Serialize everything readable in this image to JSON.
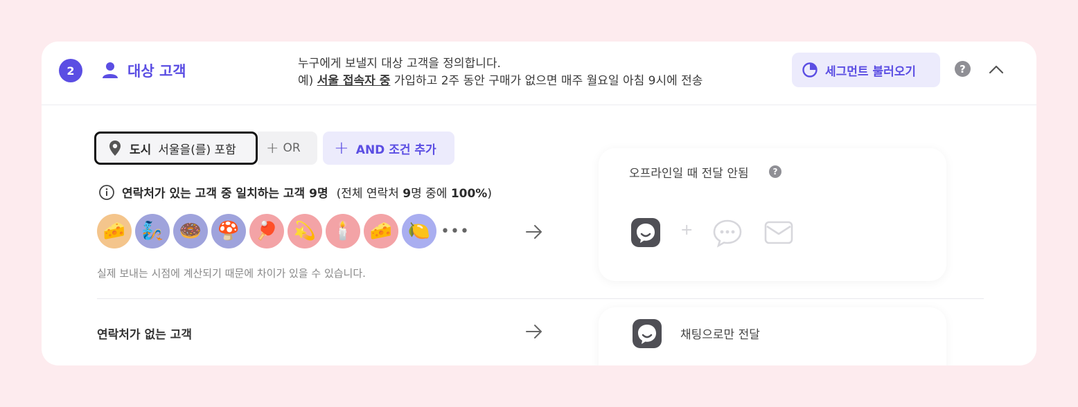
{
  "header": {
    "step_number": "2",
    "title": "대상 고객",
    "description_line1": "누구에게 보낼지 대상 고객을 정의합니다.",
    "description_prefix": "예) ",
    "description_emphasis": "서울 접속자 중",
    "description_suffix": " 가입하고 2주 동안 구매가 없으면 매주 월요일 아침 9시에 전송",
    "segment_button": "세그먼트 불러오기",
    "help_label": "?",
    "accent_color": "#5b4ee3"
  },
  "conditions": {
    "city_key": "도시",
    "city_value": "서울을(를) 포함",
    "or_label": "OR",
    "and_label": "AND 조건 추가"
  },
  "match": {
    "main": "연락처가 있는 고객 중 일치하는 고객 9명",
    "sub_prefix": "(전체 연락처 ",
    "sub_count": "9",
    "sub_middle": "명 중에 ",
    "sub_percent": "100%",
    "sub_suffix": ")"
  },
  "avatars": [
    {
      "emoji": "🧀",
      "bg": "#f4c58c"
    },
    {
      "emoji": "🧞",
      "bg": "#9fa3dc"
    },
    {
      "emoji": "🍩",
      "bg": "#9fa3dc"
    },
    {
      "emoji": "🍄",
      "bg": "#9fa3dc"
    },
    {
      "emoji": "🏓",
      "bg": "#f3a3a6"
    },
    {
      "emoji": "💫",
      "bg": "#f3a3a6"
    },
    {
      "emoji": "🕯️",
      "bg": "#f3a3a6"
    },
    {
      "emoji": "🧀",
      "bg": "#f3a3a6"
    },
    {
      "emoji": "🍋",
      "bg": "#a9aef0"
    }
  ],
  "more_label": "•••",
  "note": "실제 보내는 시점에 계산되기 때문에 차이가 있을 수 있습니다.",
  "offline": {
    "title": "오프라인일 때 전달 안됨",
    "help_label": "?",
    "plus_label": "+"
  },
  "no_contact": {
    "label": "연락처가 없는 고객",
    "channel_label": "채팅으로만 전달"
  }
}
